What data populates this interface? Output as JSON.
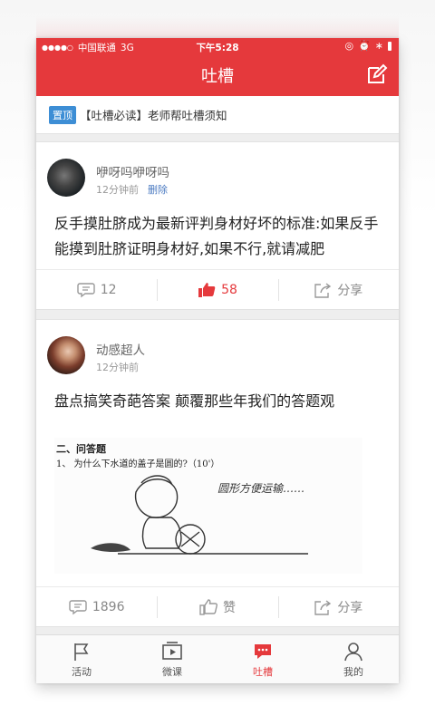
{
  "status_bar": {
    "carrier": "中国联通",
    "network": "3G",
    "time": "下午5:28"
  },
  "header": {
    "title": "吐槽",
    "edit_icon": "edit-icon"
  },
  "notice": {
    "badge": "置顶",
    "text": "【吐槽必读】老师帮吐槽须知"
  },
  "posts": [
    {
      "user": "咿呀吗咿呀吗",
      "time": "12分钟前",
      "delete_label": "删除",
      "text": "反手摸肚脐成为最新评判身材好坏的标准:如果反手能摸到肚脐证明身材好,如果不行,就请减肥",
      "comments": "12",
      "likes": "58",
      "share": "分享"
    },
    {
      "user": "动感超人",
      "time": "12分钟前",
      "text": "盘点搞笑奇葩答案 颠覆那些年我们的答题观",
      "image": {
        "heading": "二、问答题",
        "question": "1、  为什么下水道的盖子是圆的?（10'）",
        "answer": "圆形方便运输……"
      },
      "comments": "1896",
      "likes": "赞",
      "share": "分享"
    }
  ],
  "tabs": [
    {
      "label": "活动",
      "icon": "flag-icon"
    },
    {
      "label": "微课",
      "icon": "video-icon"
    },
    {
      "label": "吐槽",
      "icon": "chat-bubble-icon"
    },
    {
      "label": "我的",
      "icon": "user-icon"
    }
  ],
  "colors": {
    "brand_red": "#e5393c",
    "pin_blue": "#3d8ed5",
    "link_blue": "#4d7cc2"
  }
}
